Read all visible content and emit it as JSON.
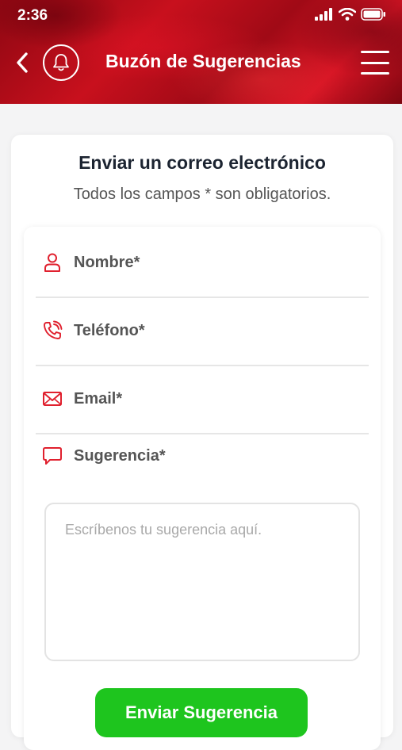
{
  "status_bar": {
    "time": "2:36"
  },
  "header": {
    "title": "Buzón de Sugerencias"
  },
  "card": {
    "title": "Enviar un correo electrónico",
    "subtitle": "Todos los campos * son obligatorios."
  },
  "form": {
    "fields": [
      {
        "label": "Nombre*",
        "icon": "user-icon"
      },
      {
        "label": "Teléfono*",
        "icon": "phone-icon"
      },
      {
        "label": "Email*",
        "icon": "mail-icon"
      }
    ],
    "suggestion": {
      "label": "Sugerencia*",
      "icon": "chat-icon",
      "placeholder": "Escríbenos tu sugerencia aquí."
    },
    "submit_label": "Enviar Sugerencia"
  },
  "colors": {
    "brand_red": "#c8101d",
    "submit_green": "#1ec51e",
    "icon_red": "#e0202e"
  }
}
